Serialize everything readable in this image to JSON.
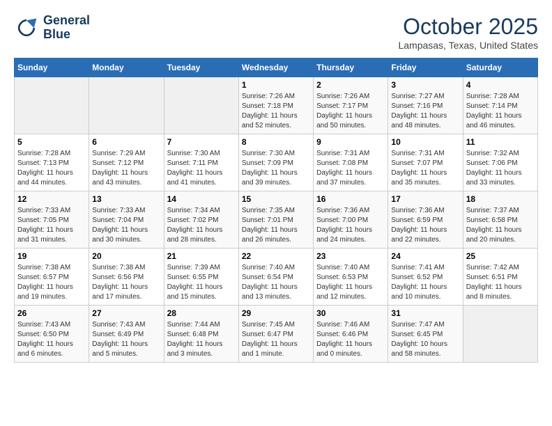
{
  "header": {
    "logo_line1": "General",
    "logo_line2": "Blue",
    "month_title": "October 2025",
    "location": "Lampasas, Texas, United States"
  },
  "weekdays": [
    "Sunday",
    "Monday",
    "Tuesday",
    "Wednesday",
    "Thursday",
    "Friday",
    "Saturday"
  ],
  "weeks": [
    [
      {
        "day": "",
        "sunrise": "",
        "sunset": "",
        "daylight": ""
      },
      {
        "day": "",
        "sunrise": "",
        "sunset": "",
        "daylight": ""
      },
      {
        "day": "",
        "sunrise": "",
        "sunset": "",
        "daylight": ""
      },
      {
        "day": "1",
        "sunrise": "Sunrise: 7:26 AM",
        "sunset": "Sunset: 7:18 PM",
        "daylight": "Daylight: 11 hours and 52 minutes."
      },
      {
        "day": "2",
        "sunrise": "Sunrise: 7:26 AM",
        "sunset": "Sunset: 7:17 PM",
        "daylight": "Daylight: 11 hours and 50 minutes."
      },
      {
        "day": "3",
        "sunrise": "Sunrise: 7:27 AM",
        "sunset": "Sunset: 7:16 PM",
        "daylight": "Daylight: 11 hours and 48 minutes."
      },
      {
        "day": "4",
        "sunrise": "Sunrise: 7:28 AM",
        "sunset": "Sunset: 7:14 PM",
        "daylight": "Daylight: 11 hours and 46 minutes."
      }
    ],
    [
      {
        "day": "5",
        "sunrise": "Sunrise: 7:28 AM",
        "sunset": "Sunset: 7:13 PM",
        "daylight": "Daylight: 11 hours and 44 minutes."
      },
      {
        "day": "6",
        "sunrise": "Sunrise: 7:29 AM",
        "sunset": "Sunset: 7:12 PM",
        "daylight": "Daylight: 11 hours and 43 minutes."
      },
      {
        "day": "7",
        "sunrise": "Sunrise: 7:30 AM",
        "sunset": "Sunset: 7:11 PM",
        "daylight": "Daylight: 11 hours and 41 minutes."
      },
      {
        "day": "8",
        "sunrise": "Sunrise: 7:30 AM",
        "sunset": "Sunset: 7:09 PM",
        "daylight": "Daylight: 11 hours and 39 minutes."
      },
      {
        "day": "9",
        "sunrise": "Sunrise: 7:31 AM",
        "sunset": "Sunset: 7:08 PM",
        "daylight": "Daylight: 11 hours and 37 minutes."
      },
      {
        "day": "10",
        "sunrise": "Sunrise: 7:31 AM",
        "sunset": "Sunset: 7:07 PM",
        "daylight": "Daylight: 11 hours and 35 minutes."
      },
      {
        "day": "11",
        "sunrise": "Sunrise: 7:32 AM",
        "sunset": "Sunset: 7:06 PM",
        "daylight": "Daylight: 11 hours and 33 minutes."
      }
    ],
    [
      {
        "day": "12",
        "sunrise": "Sunrise: 7:33 AM",
        "sunset": "Sunset: 7:05 PM",
        "daylight": "Daylight: 11 hours and 31 minutes."
      },
      {
        "day": "13",
        "sunrise": "Sunrise: 7:33 AM",
        "sunset": "Sunset: 7:04 PM",
        "daylight": "Daylight: 11 hours and 30 minutes."
      },
      {
        "day": "14",
        "sunrise": "Sunrise: 7:34 AM",
        "sunset": "Sunset: 7:02 PM",
        "daylight": "Daylight: 11 hours and 28 minutes."
      },
      {
        "day": "15",
        "sunrise": "Sunrise: 7:35 AM",
        "sunset": "Sunset: 7:01 PM",
        "daylight": "Daylight: 11 hours and 26 minutes."
      },
      {
        "day": "16",
        "sunrise": "Sunrise: 7:36 AM",
        "sunset": "Sunset: 7:00 PM",
        "daylight": "Daylight: 11 hours and 24 minutes."
      },
      {
        "day": "17",
        "sunrise": "Sunrise: 7:36 AM",
        "sunset": "Sunset: 6:59 PM",
        "daylight": "Daylight: 11 hours and 22 minutes."
      },
      {
        "day": "18",
        "sunrise": "Sunrise: 7:37 AM",
        "sunset": "Sunset: 6:58 PM",
        "daylight": "Daylight: 11 hours and 20 minutes."
      }
    ],
    [
      {
        "day": "19",
        "sunrise": "Sunrise: 7:38 AM",
        "sunset": "Sunset: 6:57 PM",
        "daylight": "Daylight: 11 hours and 19 minutes."
      },
      {
        "day": "20",
        "sunrise": "Sunrise: 7:38 AM",
        "sunset": "Sunset: 6:56 PM",
        "daylight": "Daylight: 11 hours and 17 minutes."
      },
      {
        "day": "21",
        "sunrise": "Sunrise: 7:39 AM",
        "sunset": "Sunset: 6:55 PM",
        "daylight": "Daylight: 11 hours and 15 minutes."
      },
      {
        "day": "22",
        "sunrise": "Sunrise: 7:40 AM",
        "sunset": "Sunset: 6:54 PM",
        "daylight": "Daylight: 11 hours and 13 minutes."
      },
      {
        "day": "23",
        "sunrise": "Sunrise: 7:40 AM",
        "sunset": "Sunset: 6:53 PM",
        "daylight": "Daylight: 11 hours and 12 minutes."
      },
      {
        "day": "24",
        "sunrise": "Sunrise: 7:41 AM",
        "sunset": "Sunset: 6:52 PM",
        "daylight": "Daylight: 11 hours and 10 minutes."
      },
      {
        "day": "25",
        "sunrise": "Sunrise: 7:42 AM",
        "sunset": "Sunset: 6:51 PM",
        "daylight": "Daylight: 11 hours and 8 minutes."
      }
    ],
    [
      {
        "day": "26",
        "sunrise": "Sunrise: 7:43 AM",
        "sunset": "Sunset: 6:50 PM",
        "daylight": "Daylight: 11 hours and 6 minutes."
      },
      {
        "day": "27",
        "sunrise": "Sunrise: 7:43 AM",
        "sunset": "Sunset: 6:49 PM",
        "daylight": "Daylight: 11 hours and 5 minutes."
      },
      {
        "day": "28",
        "sunrise": "Sunrise: 7:44 AM",
        "sunset": "Sunset: 6:48 PM",
        "daylight": "Daylight: 11 hours and 3 minutes."
      },
      {
        "day": "29",
        "sunrise": "Sunrise: 7:45 AM",
        "sunset": "Sunset: 6:47 PM",
        "daylight": "Daylight: 11 hours and 1 minute."
      },
      {
        "day": "30",
        "sunrise": "Sunrise: 7:46 AM",
        "sunset": "Sunset: 6:46 PM",
        "daylight": "Daylight: 11 hours and 0 minutes."
      },
      {
        "day": "31",
        "sunrise": "Sunrise: 7:47 AM",
        "sunset": "Sunset: 6:45 PM",
        "daylight": "Daylight: 10 hours and 58 minutes."
      },
      {
        "day": "",
        "sunrise": "",
        "sunset": "",
        "daylight": ""
      }
    ]
  ]
}
